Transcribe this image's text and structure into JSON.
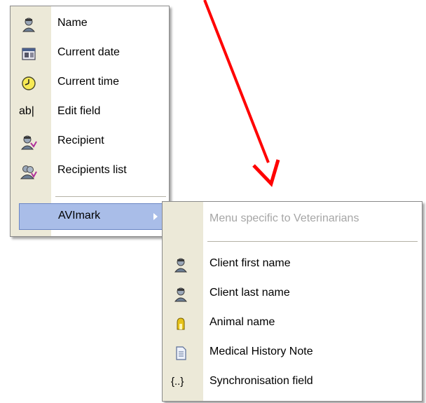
{
  "main_menu": {
    "items": [
      {
        "label": "Name",
        "icon": "person-icon"
      },
      {
        "label": "Current date",
        "icon": "calendar-icon"
      },
      {
        "label": "Current time",
        "icon": "clock-icon"
      },
      {
        "label": "Edit field",
        "icon": "edit-field-icon",
        "icon_text": "ab|"
      },
      {
        "label": "Recipient",
        "icon": "recipient-icon"
      },
      {
        "label": "Recipients list",
        "icon": "recipients-list-icon"
      }
    ],
    "submenu_item": {
      "label": "AVImark",
      "icon": "submenu-arrow-icon"
    }
  },
  "submenu": {
    "header": "Menu specific to Veterinarians",
    "items": [
      {
        "label": "Client first name",
        "icon": "person-icon"
      },
      {
        "label": "Client last name",
        "icon": "person-icon"
      },
      {
        "label": "Animal name",
        "icon": "animal-icon"
      },
      {
        "label": "Medical History Note",
        "icon": "document-icon"
      },
      {
        "label": "Synchronisation field",
        "icon": "sync-field-icon",
        "icon_text": "{..}"
      }
    ]
  },
  "colors": {
    "gutter": "#ece9d8",
    "highlight": "#a9bde8",
    "arrow": "#ff0000",
    "disabled_text": "#a6a6a6"
  }
}
